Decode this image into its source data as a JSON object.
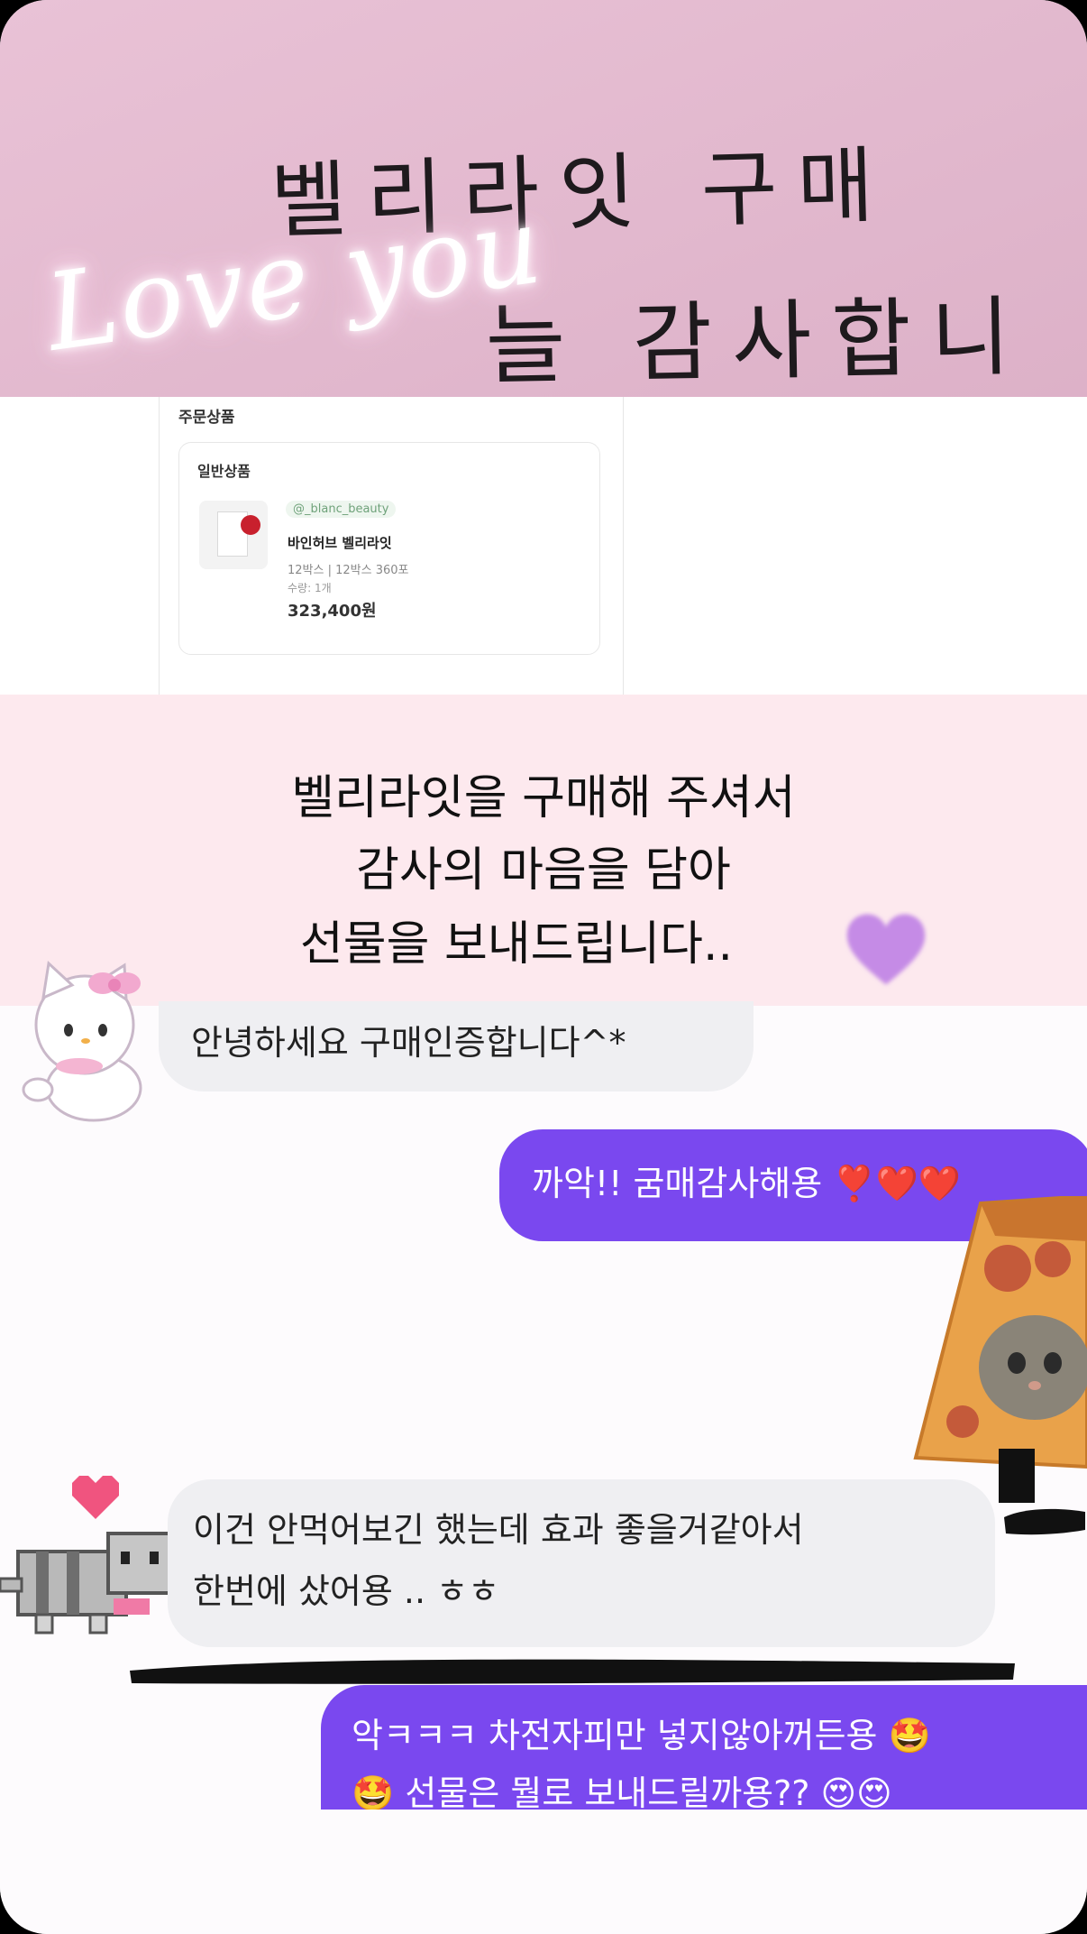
{
  "header": {
    "line1": "벨리라잇 구매",
    "line2": "늘 감사합니다.",
    "script_text": "Love you",
    "bg_color": "#e7bfd3"
  },
  "order": {
    "section_title": "주문상품",
    "card_title": "일반상품",
    "seller": "@_blanc_beauty",
    "product_name": "바인허브 벨리라잇",
    "option": "12박스 | 12박스 360포",
    "quantity": "수량: 1개",
    "price": "323,400원"
  },
  "banner": {
    "line1": "벨리라잇을 구매해 주셔서",
    "line2": "감사의 마음을 담아",
    "line3": "선물을 보내드립니다..",
    "bg_color": "#fde9ee",
    "heart_icon": "purple-heart-icon"
  },
  "chat": {
    "incoming_1": "안녕하세요 구매인증합니다^*",
    "outgoing_1": "까악!! 굼매감사해용 ❣️❤️❤️",
    "incoming_2_line1": "이건 안먹어보긴 했는데 효과 좋을거같아서",
    "incoming_2_line2": "한번에 샀어용 .. ㅎㅎ",
    "outgoing_2_line1": "악ㅋㅋㅋ 차전자피만 넣지않아꺼든용 🤩",
    "outgoing_2_line2": "🤩 선물은 뭘로 보내드릴까용?? 😍😍",
    "incoming_color": "#efeff2",
    "outgoing_color": "#7a48ef"
  },
  "stickers": {
    "kitty": "white-kitten-sticker",
    "pizza_cat": "pizza-cat-sticker",
    "pixel_cat": "pixel-cat-sticker",
    "pink_heart": "pink-pixel-heart-icon"
  }
}
